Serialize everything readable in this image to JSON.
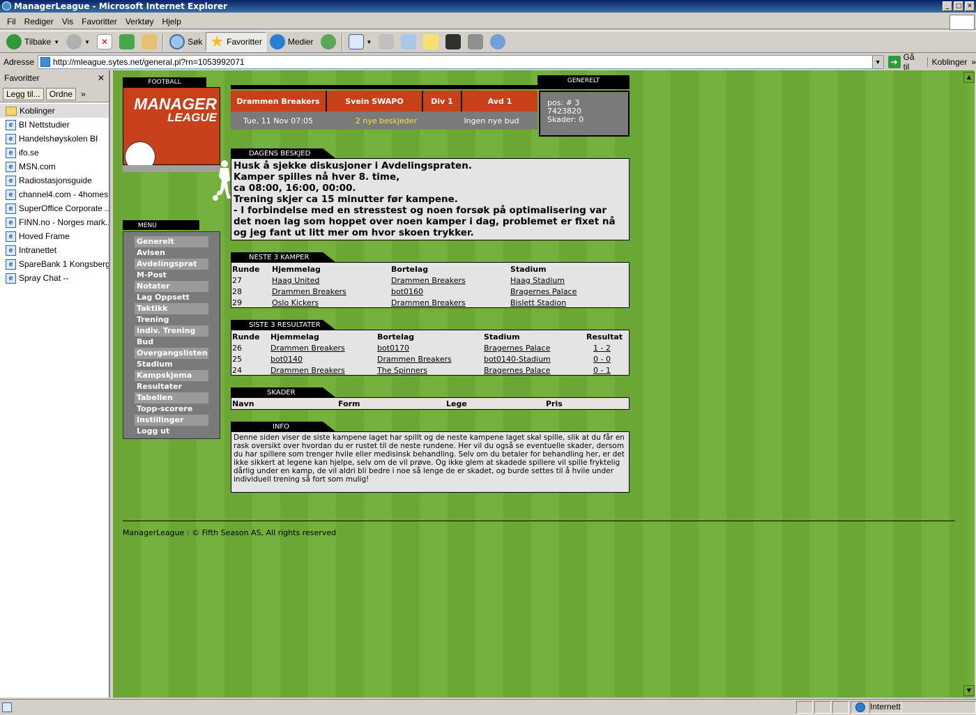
{
  "window": {
    "title": "ManagerLeague - Microsoft Internet Explorer"
  },
  "menubar": [
    "Fil",
    "Rediger",
    "Vis",
    "Favoritter",
    "Verktøy",
    "Hjelp"
  ],
  "toolbar": {
    "back": "Tilbake",
    "search": "Søk",
    "favorites": "Favoritter",
    "media": "Medier"
  },
  "address": {
    "label": "Adresse",
    "url": "http://mleague.sytes.net/general.pl?rn=1053992071",
    "go": "Gå til",
    "links": "Koblinger"
  },
  "favorites": {
    "title": "Favoritter",
    "add": "Legg til...",
    "organize": "Ordne",
    "items": [
      "Koblinger",
      "BI Nettstudier",
      "Handelshøyskolen BI",
      "ifo.se",
      "MSN.com",
      "Radiostasjonsguide",
      "channel4.com - 4homes",
      "SuperOffice Corporate ...",
      "FINN.no - Norges mark...",
      "Hoved Frame",
      "Intranettet",
      "SpareBank 1 Kongsberg",
      "Spray Chat --"
    ]
  },
  "logo": {
    "tab": "FOOTBALL",
    "line1": "MANAGER",
    "line2": "LEAGUE"
  },
  "menu": {
    "tab": "MENU",
    "items": [
      "Generelt",
      "Avisen",
      "Avdelingsprat",
      "M-Post",
      "Notater",
      "Lag Oppsett",
      "Taktikk",
      "Trening",
      "Indiv. Trening",
      "Bud",
      "Overgangslisten",
      "Stadium",
      "Kampskjema",
      "Resultater",
      "Tabellen",
      "Topp-scorere",
      "Instillinger",
      "Logg ut"
    ]
  },
  "header": {
    "gen_tab": "GENERELT",
    "team": "Drammen Breakers",
    "manager": "Svein SWAPO",
    "division": "Div 1",
    "group": "Avd 1",
    "date": "Tue, 11 Nov 07:05",
    "messages": "2 nye beskjeder",
    "bids": "Ingen nye bud",
    "pos": "pos: # 3",
    "money": "7423820",
    "injuries": "Skader: 0"
  },
  "dagens": {
    "tab": "DAGENS BESKJED",
    "lines": [
      "Husk å sjekke diskusjoner i Avdelingspraten.",
      "Kamper spilles nå hver 8. time,",
      "ca 08:00, 16:00, 00:00.",
      "Trening skjer ca 15 minutter før kampene.",
      "- I forbindelse med en stresstest og noen forsøk på optimalisering var det noen lag som hoppet over noen kamper i dag, problemet er fixet nå og jeg fant ut litt mer om hvor skoen trykker."
    ]
  },
  "next": {
    "tab": "NESTE 3 KAMPER",
    "headers": [
      "Runde",
      "Hjemmelag",
      "Bortelag",
      "Stadium"
    ],
    "rows": [
      [
        "27",
        "Haag United",
        "Drammen Breakers",
        "Haag Stadium"
      ],
      [
        "28",
        "Drammen Breakers",
        "bot0160",
        "Bragernes Palace"
      ],
      [
        "29",
        "Oslo Kickers",
        "Drammen Breakers",
        "Bislett Stadion"
      ]
    ]
  },
  "last": {
    "tab": "SISTE 3 RESULTATER",
    "headers": [
      "Runde",
      "Hjemmelag",
      "Bortelag",
      "Stadium",
      "Resultat"
    ],
    "rows": [
      [
        "26",
        "Drammen Breakers",
        "bot0170",
        "Bragernes Palace",
        "1 - 2"
      ],
      [
        "25",
        "bot0140",
        "Drammen Breakers",
        "bot0140-Stadium",
        "0 - 0"
      ],
      [
        "24",
        "Drammen Breakers",
        "The Spinners",
        "Bragernes Palace",
        "0 - 1"
      ]
    ]
  },
  "injuries": {
    "tab": "SKADER",
    "headers": [
      "Navn",
      "Form",
      "Lege",
      "Pris"
    ]
  },
  "info": {
    "tab": "INFO",
    "text": "Denne siden viser de siste kampene laget har spillt og de neste kampene laget skal spille, slik at du får en rask oversikt over hvordan du er rustet til de neste rundene. Her vil du også se eventuelle skader, dersom du har spillere som trenger hvile eller medisinsk behandling. Selv om du betaler for behandling her, er det ikke sikkert at legene kan hjelpe, selv om de vil prøve. Og ikke glem at skadede spillere vil spille fryktelig dårlig under en kamp, de vil aldri bli bedre i noe så lenge de er skadet, og burde settes til å hvile under individuell trening så fort som mulig!"
  },
  "footer": "ManagerLeague : © Fifth Season AS, All rights reserved",
  "status": {
    "zone": "Internett"
  },
  "colors": {
    "field_green": "#6aa734",
    "accent_red": "#c8401a",
    "panel_grey": "#7a7a7a"
  }
}
